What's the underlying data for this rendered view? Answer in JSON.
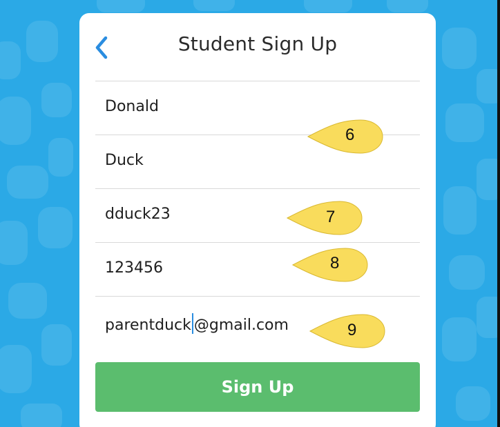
{
  "colors": {
    "background": "#2ba9e6",
    "card": "#ffffff",
    "accent": "#2a8de0",
    "button": "#5bbd6e",
    "callout": "#f9dc5c"
  },
  "header": {
    "title": "Student Sign Up",
    "back_icon": "chevron-left-icon"
  },
  "form": {
    "fields": [
      {
        "name": "first-name",
        "value": "Donald"
      },
      {
        "name": "last-name",
        "value": "Duck"
      },
      {
        "name": "username",
        "value": "dduck23"
      },
      {
        "name": "password",
        "value": "123456"
      },
      {
        "name": "parent-email",
        "value_before_caret": "parentduck",
        "value_after_caret": "@gmail.com"
      }
    ]
  },
  "signup_button": {
    "label": "Sign Up"
  },
  "callouts": [
    "6",
    "7",
    "8",
    "9"
  ]
}
